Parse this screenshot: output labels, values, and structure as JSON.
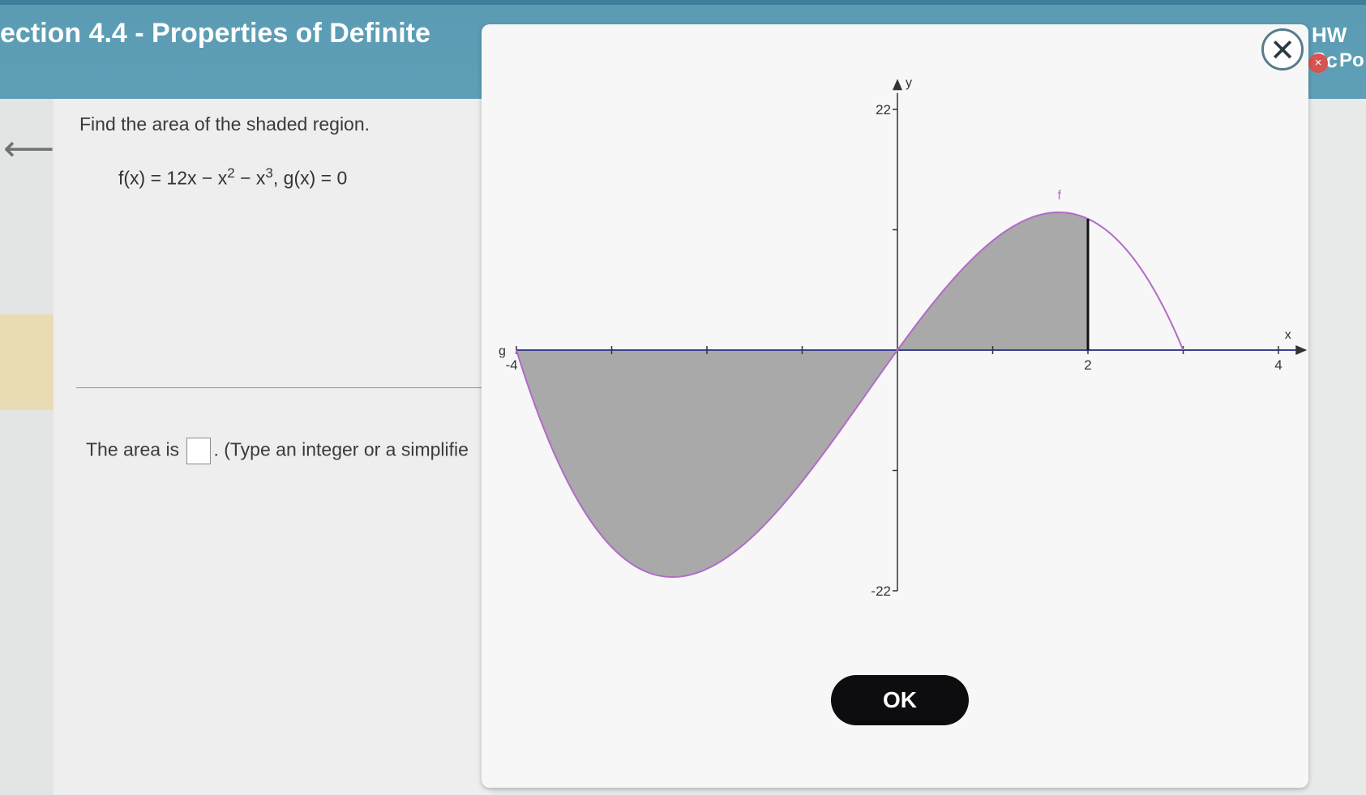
{
  "header": {
    "section_title": "ection 4.4 - Properties of Definite",
    "hw_score": "HW Sc",
    "points": "Po"
  },
  "problem": {
    "prompt": "Find the area of the shaded region.",
    "f_prefix": "f(x) = 12x − x",
    "f_exp1": "2",
    "f_mid": " − x",
    "f_exp2": "3",
    "g_part": ", g(x) = 0",
    "answer_prefix": "The area is",
    "answer_suffix": ". (Type an integer or a simplifie",
    "answer_value": ""
  },
  "popup": {
    "ok_label": "OK",
    "close_icon": "close-icon"
  },
  "chart_data": {
    "type": "line",
    "functions": [
      {
        "name": "f",
        "expression": "12x - x^2 - x^3"
      },
      {
        "name": "g",
        "expression": "0"
      }
    ],
    "shaded_region": {
      "x_from": -4,
      "x_to": 2
    },
    "xlim": [
      -4,
      4
    ],
    "ylim": [
      -22,
      22
    ],
    "x_ticks": [
      "-4",
      "2",
      "4"
    ],
    "y_ticks": [
      "22",
      "-22"
    ],
    "xlabel": "x",
    "ylabel": "y",
    "curve_labels": [
      "f",
      "g"
    ],
    "curve_color": "#b36ac8",
    "axis_color": "#3d3f8f",
    "shade_color": "#a9a9a9"
  }
}
